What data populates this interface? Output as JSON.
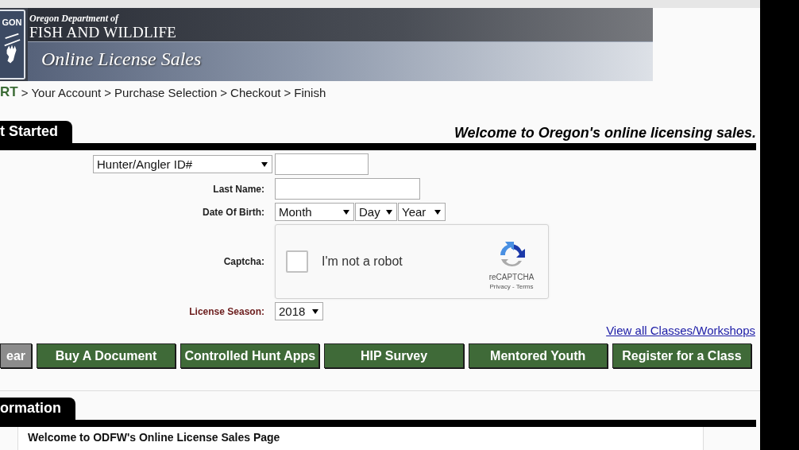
{
  "banner": {
    "logo_text": "GON",
    "agency_line": "Oregon Department of",
    "agency_name": "FISH AND WILDLIFE",
    "title": "Online License Sales"
  },
  "breadcrumb": {
    "separator": ">",
    "steps": [
      {
        "label": "RT",
        "selected": true
      },
      {
        "label": "Your Account",
        "selected": false
      },
      {
        "label": "Purchase Selection",
        "selected": false
      },
      {
        "label": "Checkout",
        "selected": false
      },
      {
        "label": "Finish",
        "selected": false
      }
    ]
  },
  "start_section": {
    "tab": "t Started",
    "welcome": "Welcome to Oregon's online licensing sales."
  },
  "form": {
    "rows": [
      {
        "kind": "id_select",
        "select": "Hunter/Angler ID#"
      },
      {
        "kind": "text",
        "label": "Last Name:",
        "highlighted": false
      },
      {
        "kind": "date",
        "label": "Date Of Birth:",
        "highlighted": false,
        "selects": [
          "Month",
          "Day",
          "Year"
        ]
      },
      {
        "kind": "captcha",
        "label": "Captcha:",
        "highlighted": false,
        "checkbox_label": "I'm not a robot",
        "checked": false,
        "brand": "reCAPTCHA",
        "links": "Privacy - Terms"
      },
      {
        "kind": "select",
        "label": "License Season:",
        "highlighted": true,
        "value": "2018"
      }
    ]
  },
  "classes_link": "View all Classes/Workshops",
  "buttons": [
    {
      "label": "ear",
      "disabled": true
    },
    {
      "label": "Buy A Document",
      "disabled": false
    },
    {
      "label": "Controlled Hunt Apps",
      "disabled": false
    },
    {
      "label": "HIP Survey",
      "disabled": false
    },
    {
      "label": "Mentored Youth",
      "disabled": false
    },
    {
      "label": "Register for a Class",
      "disabled": false
    }
  ],
  "info_section": {
    "tab": "ormation",
    "box_title": "Welcome to ODFW's Online License Sales Page"
  }
}
